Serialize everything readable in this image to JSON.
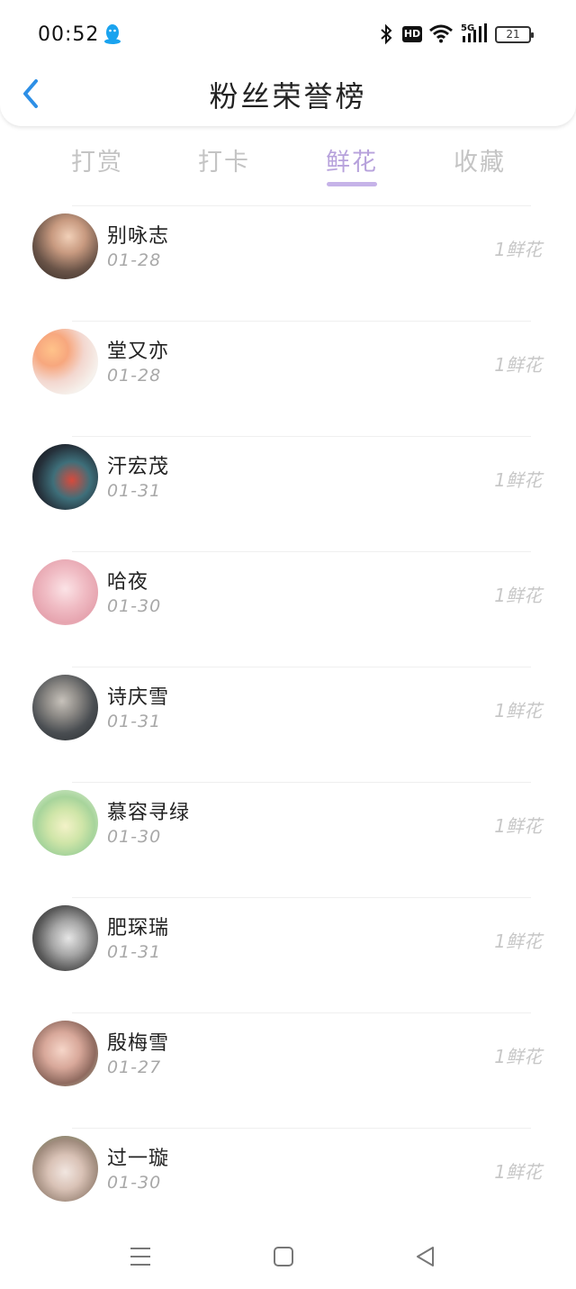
{
  "status_bar": {
    "time": "00:52",
    "network": "5G",
    "hd_label": "HD",
    "battery": "21"
  },
  "header": {
    "title": "粉丝荣誉榜",
    "back_icon": "chevron-left-icon"
  },
  "tabs": [
    {
      "label": "打赏",
      "active": false
    },
    {
      "label": "打卡",
      "active": false
    },
    {
      "label": "鲜花",
      "active": true
    },
    {
      "label": "收藏",
      "active": false
    }
  ],
  "colors": {
    "accent": "#b7a2dc",
    "back_arrow": "#2d8fe6",
    "qq_icon": "#1aa3ef"
  },
  "fans": [
    {
      "name": "别咏志",
      "date": "01-28",
      "amount": "1鲜花"
    },
    {
      "name": "堂又亦",
      "date": "01-28",
      "amount": "1鲜花"
    },
    {
      "name": "汗宏茂",
      "date": "01-31",
      "amount": "1鲜花"
    },
    {
      "name": "哈夜",
      "date": "01-30",
      "amount": "1鲜花"
    },
    {
      "name": "诗庆雪",
      "date": "01-31",
      "amount": "1鲜花"
    },
    {
      "name": "慕容寻绿",
      "date": "01-30",
      "amount": "1鲜花"
    },
    {
      "name": "肥琛瑞",
      "date": "01-31",
      "amount": "1鲜花"
    },
    {
      "name": "殷梅雪",
      "date": "01-27",
      "amount": "1鲜花"
    },
    {
      "name": "过一璇",
      "date": "01-30",
      "amount": "1鲜花"
    }
  ],
  "nav_bar": {
    "items": [
      "menu-icon",
      "home-icon",
      "back-icon"
    ]
  }
}
